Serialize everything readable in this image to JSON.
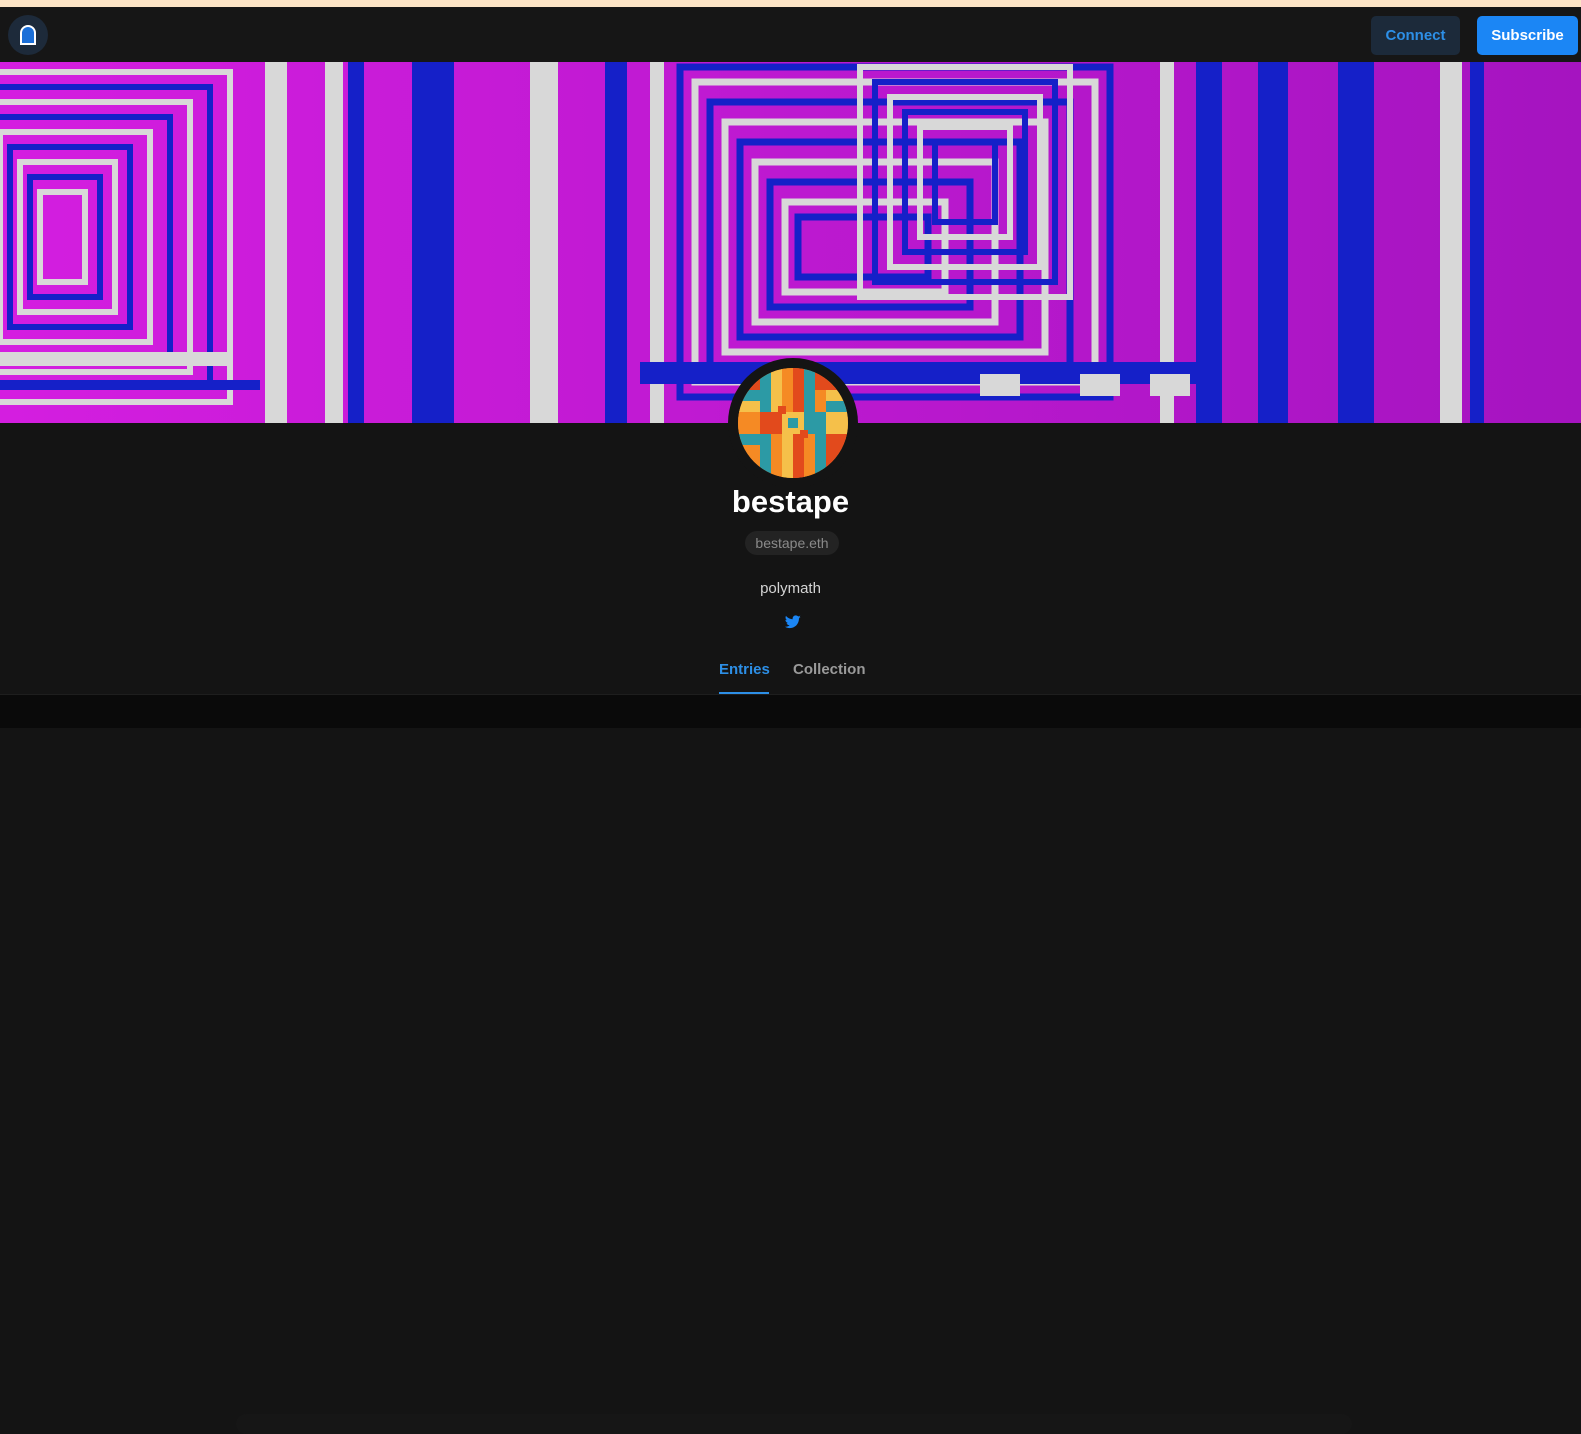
{
  "header": {
    "logo_icon": "mirror-arch-icon",
    "connect_label": "Connect",
    "subscribe_label": "Subscribe"
  },
  "cover": {
    "image": "cover-banner-image",
    "colors": [
      "#c21ad2",
      "#1520c8",
      "#d8d8d8",
      "#8a1aa8"
    ]
  },
  "profile": {
    "avatar": "avatar-image",
    "name": "bestape",
    "ens": "bestape.eth",
    "bio": "polymath",
    "social_icon": "twitter-icon"
  },
  "tabs": [
    {
      "label": "Entries",
      "active": true
    },
    {
      "label": "Collection",
      "active": false
    }
  ],
  "colors": {
    "accent": "#1b86f5",
    "background": "#141414"
  }
}
